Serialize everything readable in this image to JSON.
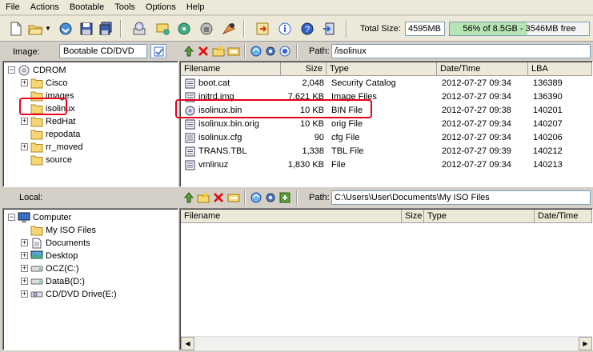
{
  "menu": [
    "File",
    "Actions",
    "Bootable",
    "Tools",
    "Options",
    "Help"
  ],
  "total": {
    "label": "Total Size:",
    "value": "4595MB",
    "percent": 56,
    "bar_text": "56% of 8.5GB - 3546MB free"
  },
  "image": {
    "label": "Image:",
    "type": "Bootable CD/DVD"
  },
  "iso_tree": [
    {
      "label": "CDROM",
      "level": 0,
      "expander": "minus",
      "icon": "cd-icon"
    },
    {
      "label": "Cisco",
      "level": 1,
      "expander": "plus",
      "icon": "folder-icon"
    },
    {
      "label": "images",
      "level": 1,
      "expander": "",
      "icon": "folder-icon"
    },
    {
      "label": "isolinux",
      "level": 1,
      "expander": "",
      "icon": "folder-icon"
    },
    {
      "label": "RedHat",
      "level": 1,
      "expander": "plus",
      "icon": "folder-icon"
    },
    {
      "label": "repodata",
      "level": 1,
      "expander": "",
      "icon": "folder-icon"
    },
    {
      "label": "rr_moved",
      "level": 1,
      "expander": "plus",
      "icon": "folder-icon"
    },
    {
      "label": "source",
      "level": 1,
      "expander": "",
      "icon": "folder-icon"
    }
  ],
  "iso_path": {
    "label": "Path:",
    "value": "/isolinux"
  },
  "iso_columns": [
    "Filename",
    "Size",
    "Type",
    "Date/Time",
    "LBA"
  ],
  "iso_files": [
    {
      "name": "boot.cat",
      "size": "2,048",
      "type": "Security Catalog",
      "date": "2012-07-27 09:34",
      "lba": "136389"
    },
    {
      "name": "initrd.img",
      "size": "7,621 KB",
      "type": "Image Files",
      "date": "2012-07-27 09:34",
      "lba": "136390"
    },
    {
      "name": "isolinux.bin",
      "size": "10 KB",
      "type": "BIN File",
      "date": "2012-07-27 09:38",
      "lba": "140201"
    },
    {
      "name": "isolinux.bin.orig",
      "size": "10 KB",
      "type": "orig File",
      "date": "2012-07-27 09:34",
      "lba": "140207"
    },
    {
      "name": "isolinux.cfg",
      "size": "90",
      "type": "cfg File",
      "date": "2012-07-27 09:34",
      "lba": "140206"
    },
    {
      "name": "TRANS.TBL",
      "size": "1,338",
      "type": "TBL File",
      "date": "2012-07-27 09:39",
      "lba": "140212"
    },
    {
      "name": "vmlinuz",
      "size": "1,830 KB",
      "type": "File",
      "date": "2012-07-27 09:34",
      "lba": "140213"
    }
  ],
  "local": {
    "label": "Local:"
  },
  "local_tree": [
    {
      "label": "Computer",
      "level": 0,
      "expander": "minus",
      "icon": "computer-icon"
    },
    {
      "label": "My ISO Files",
      "level": 1,
      "expander": "",
      "icon": "folder-icon"
    },
    {
      "label": "Documents",
      "level": 1,
      "expander": "plus",
      "icon": "documents-icon"
    },
    {
      "label": "Desktop",
      "level": 1,
      "expander": "plus",
      "icon": "desktop-icon"
    },
    {
      "label": "OCZ(C:)",
      "level": 1,
      "expander": "plus",
      "icon": "drive-icon"
    },
    {
      "label": "DataB(D:)",
      "level": 1,
      "expander": "plus",
      "icon": "drive-icon"
    },
    {
      "label": "CD/DVD Drive(E:)",
      "level": 1,
      "expander": "plus",
      "icon": "cd-drive-icon"
    }
  ],
  "local_path": {
    "label": "Path:",
    "value": "C:\\Users\\User\\Documents\\My ISO Files"
  },
  "local_columns": [
    "Filename",
    "Size",
    "Type",
    "Date/Time"
  ],
  "colors": {
    "highlight": "#e8001c",
    "bar_fill": "#b7e4b5",
    "folder": "#f7d774"
  }
}
